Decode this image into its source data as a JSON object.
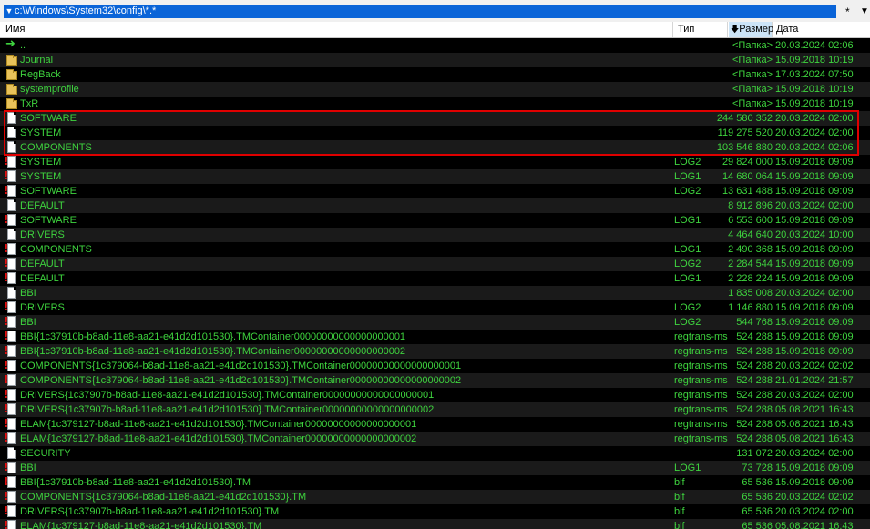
{
  "path": {
    "value": "c:\\Windows\\System32\\config\\*.*"
  },
  "filter": {
    "value": "*"
  },
  "columns": {
    "name": "Имя",
    "type": "Тип",
    "size": "Размер",
    "date": "Дата"
  },
  "sort": {
    "column": "size",
    "icon": "sort-desc-arrow-icon"
  },
  "highlight": {
    "color": "#e00000",
    "rows": [
      5,
      6,
      7
    ]
  },
  "colors": {
    "text": "#3ed33e",
    "path_bg": "#0a64d8",
    "highlight": "#e00000"
  },
  "files": [
    {
      "icon": "up",
      "name": "..",
      "type": "",
      "size": "<Папка>",
      "date": "20.03.2024 02:06"
    },
    {
      "icon": "folder",
      "name": "Journal",
      "type": "",
      "size": "<Папка>",
      "date": "15.09.2018 10:19"
    },
    {
      "icon": "folder",
      "name": "RegBack",
      "type": "",
      "size": "<Папка>",
      "date": "17.03.2024 07:50"
    },
    {
      "icon": "folder",
      "name": "systemprofile",
      "type": "",
      "size": "<Папка>",
      "date": "15.09.2018 10:19"
    },
    {
      "icon": "folder",
      "name": "TxR",
      "type": "",
      "size": "<Папка>",
      "date": "15.09.2018 10:19"
    },
    {
      "icon": "file",
      "name": "SOFTWARE",
      "type": "",
      "size": "244 580 352",
      "date": "20.03.2024 02:00"
    },
    {
      "icon": "file",
      "name": "SYSTEM",
      "type": "",
      "size": "119 275 520",
      "date": "20.03.2024 02:00"
    },
    {
      "icon": "file",
      "name": "COMPONENTS",
      "type": "",
      "size": "103 546 880",
      "date": "20.03.2024 02:06"
    },
    {
      "icon": "sys",
      "name": "SYSTEM",
      "type": "LOG2",
      "size": "29 824 000",
      "date": "15.09.2018 09:09"
    },
    {
      "icon": "sys",
      "name": "SYSTEM",
      "type": "LOG1",
      "size": "14 680 064",
      "date": "15.09.2018 09:09"
    },
    {
      "icon": "sys",
      "name": "SOFTWARE",
      "type": "LOG2",
      "size": "13 631 488",
      "date": "15.09.2018 09:09"
    },
    {
      "icon": "file",
      "name": "DEFAULT",
      "type": "",
      "size": "8 912 896",
      "date": "20.03.2024 02:00"
    },
    {
      "icon": "sys",
      "name": "SOFTWARE",
      "type": "LOG1",
      "size": "6 553 600",
      "date": "15.09.2018 09:09"
    },
    {
      "icon": "file",
      "name": "DRIVERS",
      "type": "",
      "size": "4 464 640",
      "date": "20.03.2024 10:00"
    },
    {
      "icon": "sys",
      "name": "COMPONENTS",
      "type": "LOG1",
      "size": "2 490 368",
      "date": "15.09.2018 09:09"
    },
    {
      "icon": "sys",
      "name": "DEFAULT",
      "type": "LOG2",
      "size": "2 284 544",
      "date": "15.09.2018 09:09"
    },
    {
      "icon": "sys",
      "name": "DEFAULT",
      "type": "LOG1",
      "size": "2 228 224",
      "date": "15.09.2018 09:09"
    },
    {
      "icon": "file",
      "name": "BBI",
      "type": "",
      "size": "1 835 008",
      "date": "20.03.2024 02:00"
    },
    {
      "icon": "sys",
      "name": "DRIVERS",
      "type": "LOG2",
      "size": "1 146 880",
      "date": "15.09.2018 09:09"
    },
    {
      "icon": "sys",
      "name": "BBI",
      "type": "LOG2",
      "size": "544 768",
      "date": "15.09.2018 09:09"
    },
    {
      "icon": "sys",
      "name": "BBI{1c37910b-b8ad-11e8-aa21-e41d2d101530}.TMContainer00000000000000000001",
      "type": "regtrans-ms",
      "size": "524 288",
      "date": "15.09.2018 09:09"
    },
    {
      "icon": "sys",
      "name": "BBI{1c37910b-b8ad-11e8-aa21-e41d2d101530}.TMContainer00000000000000000002",
      "type": "regtrans-ms",
      "size": "524 288",
      "date": "15.09.2018 09:09"
    },
    {
      "icon": "sys",
      "name": "COMPONENTS{1c379064-b8ad-11e8-aa21-e41d2d101530}.TMContainer00000000000000000001",
      "type": "regtrans-ms",
      "size": "524 288",
      "date": "20.03.2024 02:02"
    },
    {
      "icon": "sys",
      "name": "COMPONENTS{1c379064-b8ad-11e8-aa21-e41d2d101530}.TMContainer00000000000000000002",
      "type": "regtrans-ms",
      "size": "524 288",
      "date": "21.01.2024 21:57"
    },
    {
      "icon": "sys",
      "name": "DRIVERS{1c37907b-b8ad-11e8-aa21-e41d2d101530}.TMContainer00000000000000000001",
      "type": "regtrans-ms",
      "size": "524 288",
      "date": "20.03.2024 02:00"
    },
    {
      "icon": "sys",
      "name": "DRIVERS{1c37907b-b8ad-11e8-aa21-e41d2d101530}.TMContainer00000000000000000002",
      "type": "regtrans-ms",
      "size": "524 288",
      "date": "05.08.2021 16:43"
    },
    {
      "icon": "sys",
      "name": "ELAM{1c379127-b8ad-11e8-aa21-e41d2d101530}.TMContainer00000000000000000001",
      "type": "regtrans-ms",
      "size": "524 288",
      "date": "05.08.2021 16:43"
    },
    {
      "icon": "sys",
      "name": "ELAM{1c379127-b8ad-11e8-aa21-e41d2d101530}.TMContainer00000000000000000002",
      "type": "regtrans-ms",
      "size": "524 288",
      "date": "05.08.2021 16:43"
    },
    {
      "icon": "file",
      "name": "SECURITY",
      "type": "",
      "size": "131 072",
      "date": "20.03.2024 02:00"
    },
    {
      "icon": "sys",
      "name": "BBI",
      "type": "LOG1",
      "size": "73 728",
      "date": "15.09.2018 09:09"
    },
    {
      "icon": "sys",
      "name": "BBI{1c37910b-b8ad-11e8-aa21-e41d2d101530}.TM",
      "type": "blf",
      "size": "65 536",
      "date": "15.09.2018 09:09"
    },
    {
      "icon": "sys",
      "name": "COMPONENTS{1c379064-b8ad-11e8-aa21-e41d2d101530}.TM",
      "type": "blf",
      "size": "65 536",
      "date": "20.03.2024 02:02"
    },
    {
      "icon": "sys",
      "name": "DRIVERS{1c37907b-b8ad-11e8-aa21-e41d2d101530}.TM",
      "type": "blf",
      "size": "65 536",
      "date": "20.03.2024 02:00"
    },
    {
      "icon": "sys",
      "name": "ELAM{1c379127-b8ad-11e8-aa21-e41d2d101530}.TM",
      "type": "blf",
      "size": "65 536",
      "date": "05.08.2021 16:43"
    }
  ]
}
